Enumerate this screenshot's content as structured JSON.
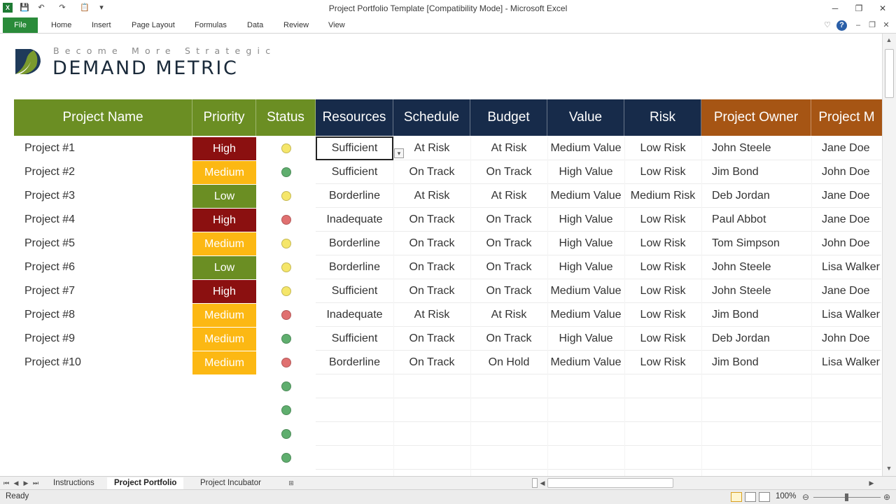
{
  "window": {
    "title": "Project Portfolio Template  [Compatibility Mode]  -  Microsoft Excel",
    "minimize": "─",
    "restore": "❐",
    "close": "✕"
  },
  "ribbon": {
    "file": "File",
    "tabs": [
      "Home",
      "Insert",
      "Page Layout",
      "Formulas",
      "Data",
      "Review",
      "View"
    ]
  },
  "logo": {
    "tagline": "Become More Strategic",
    "name": "DEMAND METRIC"
  },
  "table": {
    "headers": [
      "Project Name",
      "Priority",
      "Status",
      "Resources",
      "Schedule",
      "Budget",
      "Value",
      "Risk",
      "Project Owner",
      "Project M"
    ],
    "rows": [
      {
        "name": "Project #1",
        "priority": "High",
        "status": "yellow",
        "resources": "Sufficient",
        "schedule": "At Risk",
        "budget": "At Risk",
        "value": "Medium Value",
        "risk": "Low Risk",
        "owner": "John Steele",
        "manager": "Jane Doe"
      },
      {
        "name": "Project #2",
        "priority": "Medium",
        "status": "green",
        "resources": "Sufficient",
        "schedule": "On Track",
        "budget": "On Track",
        "value": "High Value",
        "risk": "Low Risk",
        "owner": "Jim Bond",
        "manager": "John Doe"
      },
      {
        "name": "Project #3",
        "priority": "Low",
        "status": "yellow",
        "resources": "Borderline",
        "schedule": "At Risk",
        "budget": "At Risk",
        "value": "Medium Value",
        "risk": "Medium Risk",
        "owner": "Deb Jordan",
        "manager": "Jane Doe"
      },
      {
        "name": "Project #4",
        "priority": "High",
        "status": "red",
        "resources": "Inadequate",
        "schedule": "On Track",
        "budget": "On Track",
        "value": "High Value",
        "risk": "Low Risk",
        "owner": "Paul Abbot",
        "manager": "Jane Doe"
      },
      {
        "name": "Project #5",
        "priority": "Medium",
        "status": "yellow",
        "resources": "Borderline",
        "schedule": "On Track",
        "budget": "On Track",
        "value": "High Value",
        "risk": "Low Risk",
        "owner": "Tom Simpson",
        "manager": "John Doe"
      },
      {
        "name": "Project #6",
        "priority": "Low",
        "status": "yellow",
        "resources": "Borderline",
        "schedule": "On Track",
        "budget": "On Track",
        "value": "High Value",
        "risk": "Low Risk",
        "owner": "John Steele",
        "manager": "Lisa Walker"
      },
      {
        "name": "Project #7",
        "priority": "High",
        "status": "yellow",
        "resources": "Sufficient",
        "schedule": "On Track",
        "budget": "On Track",
        "value": "Medium Value",
        "risk": "Low Risk",
        "owner": "John Steele",
        "manager": "Jane Doe"
      },
      {
        "name": "Project #8",
        "priority": "Medium",
        "status": "red",
        "resources": "Inadequate",
        "schedule": "At Risk",
        "budget": "At Risk",
        "value": "Medium Value",
        "risk": "Low Risk",
        "owner": "Jim Bond",
        "manager": "Lisa Walker"
      },
      {
        "name": "Project #9",
        "priority": "Medium",
        "status": "green",
        "resources": "Sufficient",
        "schedule": "On Track",
        "budget": "On Track",
        "value": "High Value",
        "risk": "Low Risk",
        "owner": "Deb Jordan",
        "manager": "John Doe"
      },
      {
        "name": "Project #10",
        "priority": "Medium",
        "status": "red",
        "resources": "Borderline",
        "schedule": "On Track",
        "budget": "On Hold",
        "value": "Medium Value",
        "risk": "Low Risk",
        "owner": "Jim Bond",
        "manager": "Lisa Walker"
      }
    ],
    "extra_status": [
      "green",
      "green",
      "green",
      "green"
    ]
  },
  "colors": {
    "header_green": "#6b8e23",
    "header_navy": "#172b4a",
    "header_orange": "#a65514",
    "priority_high": "#8b1010",
    "priority_medium": "#fcb813",
    "priority_low": "#6b8e23",
    "status_yellow": "#f5e66a",
    "status_green": "#5fae6e",
    "status_red": "#e07070"
  },
  "sheet_tabs": [
    "Instructions",
    "Project Portfolio",
    "Project Incubator"
  ],
  "active_sheet": "Project Portfolio",
  "status": {
    "ready": "Ready",
    "zoom": "100%"
  }
}
